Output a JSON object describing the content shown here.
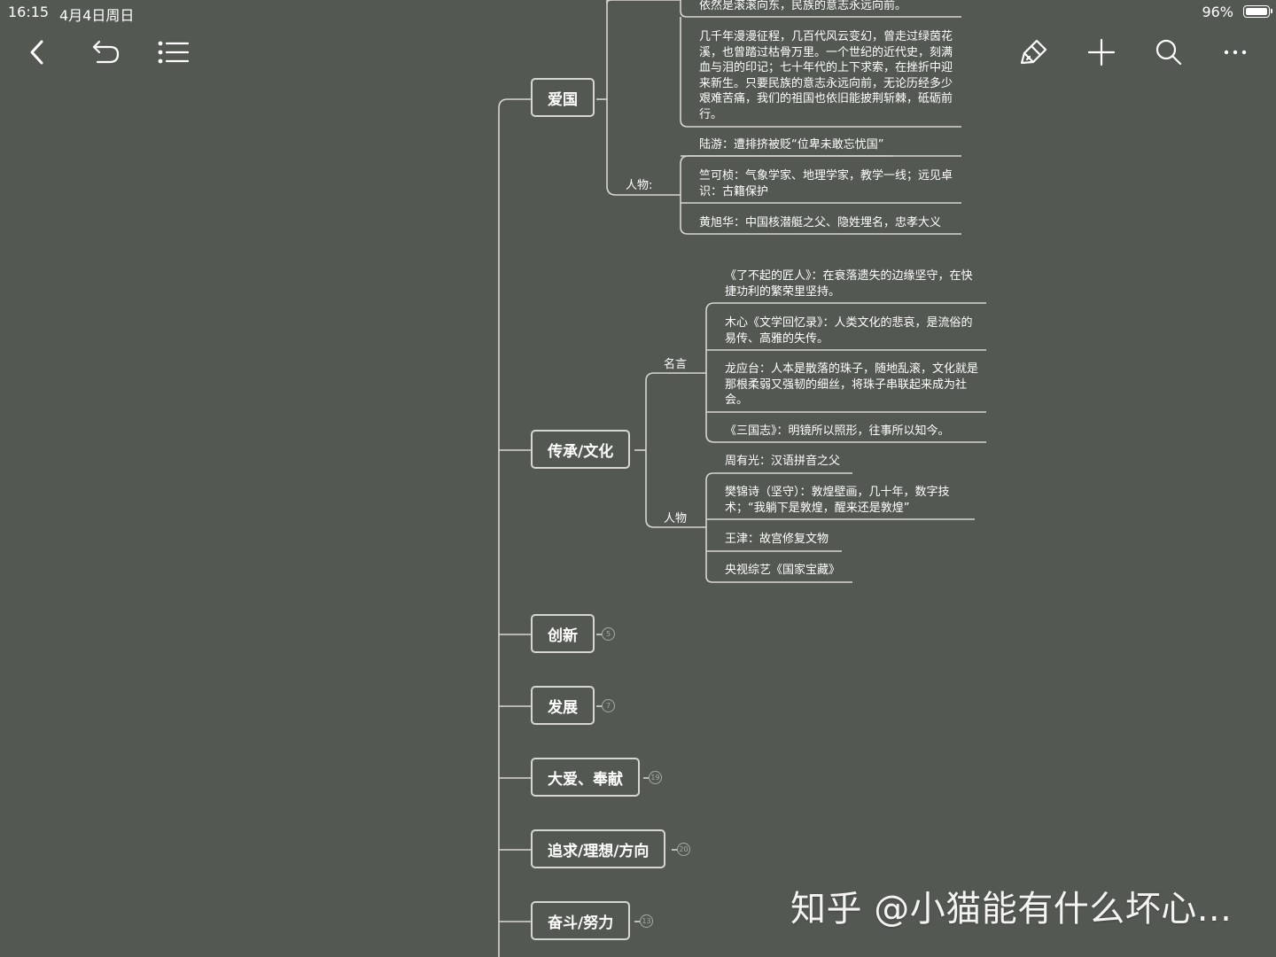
{
  "status_bar": {
    "time": "16:15",
    "date": "4月4日周日",
    "battery": "96%"
  },
  "toolbar": {
    "back_icon": "chevron-left-icon",
    "undo_icon": "undo-icon",
    "outline_icon": "list-icon",
    "format_icon": "brush-icon",
    "add_icon": "plus-icon",
    "search_icon": "search-icon",
    "more_icon": "ellipsis-icon"
  },
  "mindmap": {
    "topics": [
      {
        "label": "爱国"
      },
      {
        "label": "传承/文化"
      },
      {
        "label": "创新",
        "count": "5"
      },
      {
        "label": "发展",
        "count": "7"
      },
      {
        "label": "大爱、奉献",
        "count": "19"
      },
      {
        "label": "追求/理想/方向",
        "count": "20"
      },
      {
        "label": "奋斗/努力",
        "count": "13"
      }
    ],
    "aiguo": {
      "leaf_top": "依然是滚滚向东，民族的意志永远向前。",
      "leaf_para": "几千年漫漫征程，几百代风云变幻，曾走过绿茵花溪，也曾踏过枯骨万里。一个世纪的近代史，刻满血与泪的印记；七十年代的上下求索，在挫折中迎来新生。只要民族的意志永远向前，无论历经多少艰难苦痛，我们的祖国也依旧能披荆斩棘，砥砺前行。",
      "people_label": "人物:",
      "people": [
        "陆游：遭排挤被贬“位卑未敢忘忧国”",
        "竺可桢：气象学家、地理学家，教学一线；远见卓识：古籍保护",
        "黄旭华：中国核潜艇之父、隐姓埋名，忠孝大义"
      ]
    },
    "chuancheng": {
      "quotes_label": "名言",
      "quotes": [
        "《了不起的匠人》：在衰落遗失的边缘坚守，在快捷功利的繁荣里坚持。",
        "木心《文学回忆录》：人类文化的悲哀，是流俗的易传、高雅的失传。",
        "龙应台：人本是散落的珠子，随地乱滚，文化就是那根柔弱又强韧的细丝，将珠子串联起来成为社会。",
        "《三国志》：明镜所以照形，往事所以知今。"
      ],
      "people_label": "人物",
      "people": [
        "周有光：汉语拼音之父",
        "樊锦诗（坚守）：敦煌壁画，几十年，数字技术；“我躺下是敦煌，醒来还是敦煌”",
        "王津：故宫修复文物",
        "央视综艺《国家宝藏》"
      ]
    }
  },
  "watermark": "知乎 @小猫能有什么坏心..."
}
